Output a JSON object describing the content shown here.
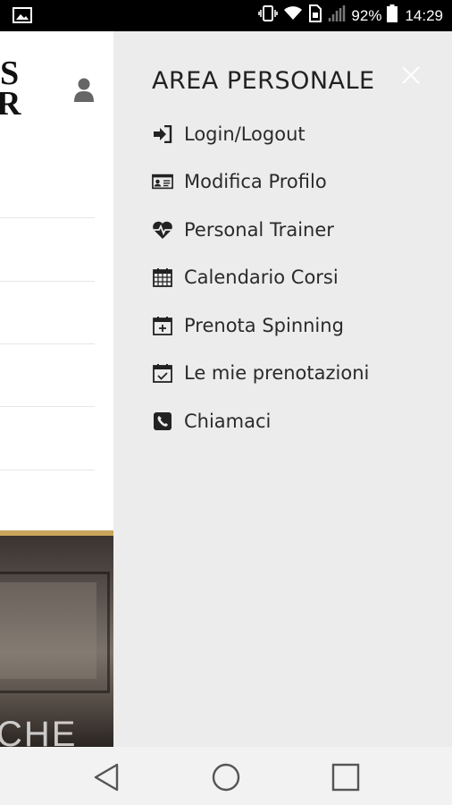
{
  "status_bar": {
    "battery_text": "92%",
    "time": "14:29",
    "icons": [
      "image-notification-icon",
      "vibrate-icon",
      "wifi-icon",
      "sim-icon",
      "signal-icon",
      "battery-icon"
    ]
  },
  "background_app": {
    "logo_lines": [
      "S",
      "R"
    ],
    "photo_text": "CHE"
  },
  "drawer": {
    "title": "AREA PERSONALE",
    "close_icon": "close-icon",
    "items": [
      {
        "label": "Login/Logout",
        "icon": "sign-in-icon"
      },
      {
        "label": "Modifica Profilo",
        "icon": "id-card-icon"
      },
      {
        "label": "Personal Trainer",
        "icon": "heartbeat-icon"
      },
      {
        "label": "Calendario Corsi",
        "icon": "calendar-icon"
      },
      {
        "label": "Prenota Spinning",
        "icon": "calendar-plus-icon"
      },
      {
        "label": "Le mie prenotazioni",
        "icon": "calendar-check-icon"
      },
      {
        "label": "Chiamaci",
        "icon": "phone-icon"
      }
    ]
  },
  "nav_bar": {
    "buttons": [
      "back-icon",
      "home-icon",
      "recents-icon"
    ]
  },
  "colors": {
    "drawer_bg": "#ececec",
    "status_bar_bg": "#000000",
    "accent_gold": "#c8a45c",
    "text": "#222222"
  }
}
